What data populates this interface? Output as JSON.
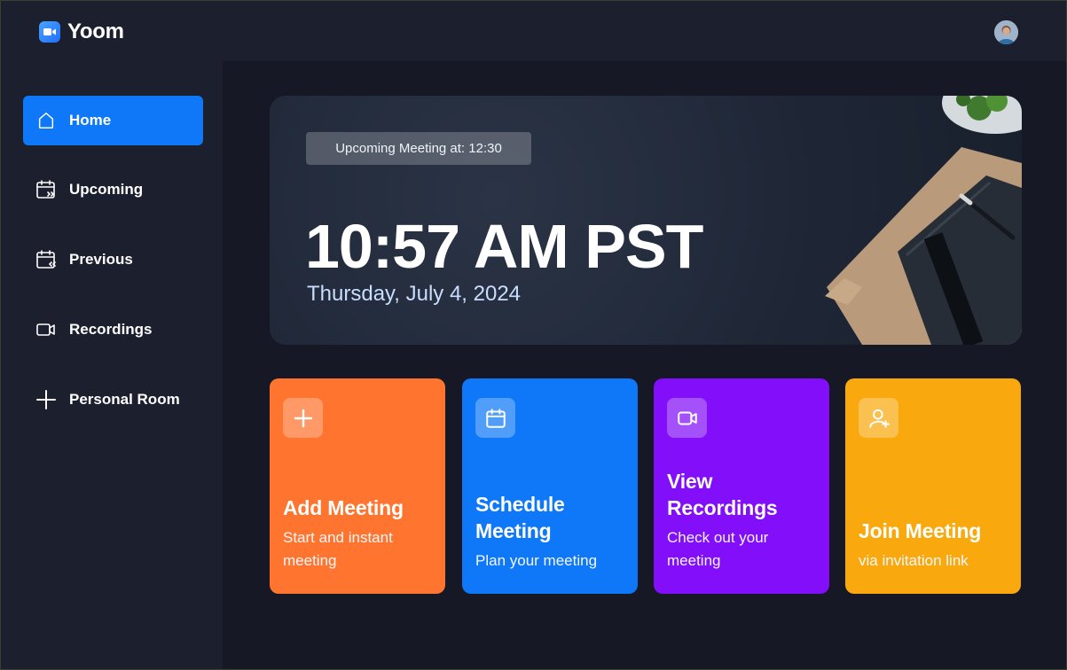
{
  "app": {
    "name": "Yoom"
  },
  "sidebar": {
    "items": [
      {
        "label": "Home",
        "icon": "home-icon",
        "active": true
      },
      {
        "label": "Upcoming",
        "icon": "calendar-forward-icon"
      },
      {
        "label": "Previous",
        "icon": "calendar-back-icon"
      },
      {
        "label": "Recordings",
        "icon": "video-icon"
      },
      {
        "label": "Personal Room",
        "icon": "plus-icon"
      }
    ]
  },
  "hero": {
    "badge": "Upcoming Meeting at: 12:30",
    "time": "10:57 AM PST",
    "date": "Thursday, July 4, 2024"
  },
  "cards": [
    {
      "title": "Add Meeting",
      "subtitle": "Start and instant meeting",
      "color": "#FF742E",
      "icon": "plus-icon"
    },
    {
      "title": "Schedule Meeting",
      "subtitle": "Plan your meeting",
      "color": "#0E78F9",
      "icon": "calendar-icon"
    },
    {
      "title": "View Recordings",
      "subtitle": "Check out your meeting",
      "color": "#830EF9",
      "icon": "video-icon"
    },
    {
      "title": "Join Meeting",
      "subtitle": "via invitation link",
      "color": "#F9A90E",
      "icon": "add-user-icon"
    }
  ],
  "colors": {
    "background": "#1C1F2E",
    "main": "#161925",
    "accent": "#0E78F9"
  }
}
